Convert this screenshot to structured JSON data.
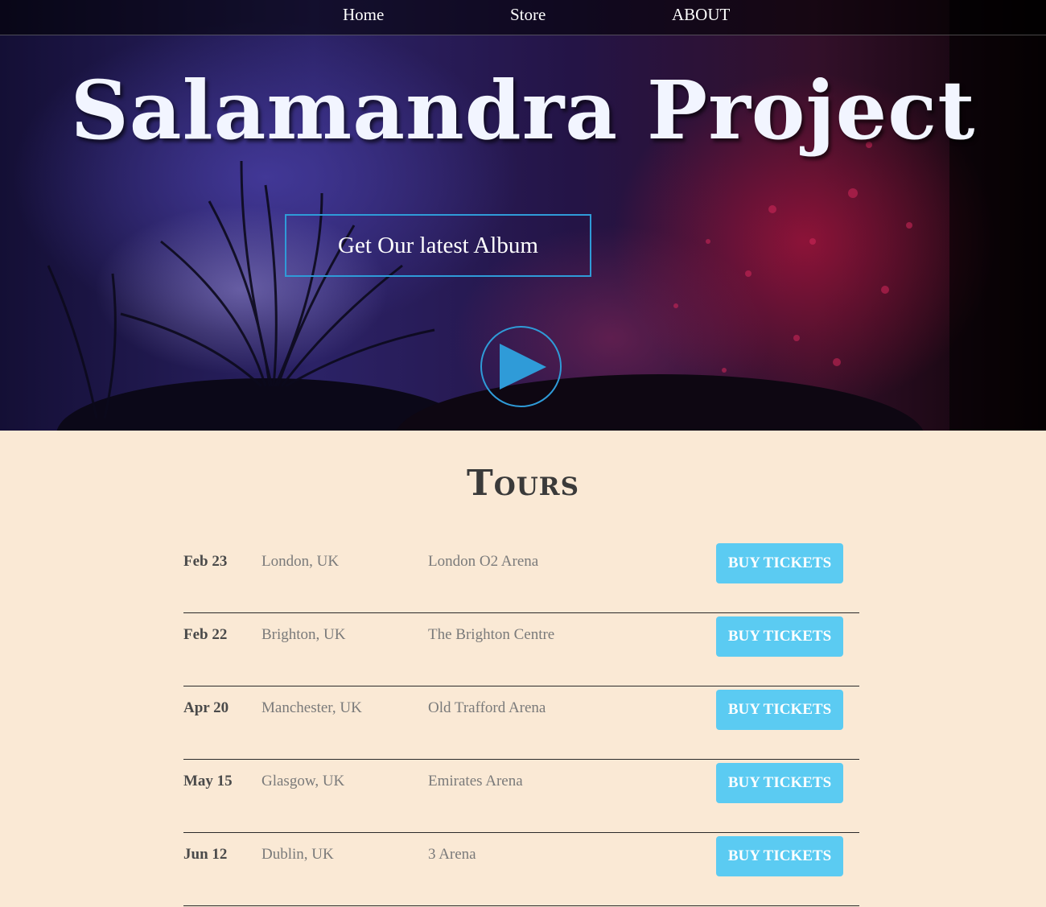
{
  "nav": {
    "home": "Home",
    "store": "Store",
    "about": "ABOUT"
  },
  "hero": {
    "title": "Salamandra Project",
    "album_button": "Get Our latest Album",
    "play_icon": "play-icon",
    "accent_color": "#2f9bd8"
  },
  "tours": {
    "title": "Tours",
    "button_color": "#5bcbf2",
    "rows": [
      {
        "date": "Feb 23",
        "city": "London, UK",
        "venue": "London O2 Arena",
        "button": "BUY TICKETS"
      },
      {
        "date": "Feb 22",
        "city": "Brighton, UK",
        "venue": "The Brighton Centre",
        "button": "BUY TICKETS"
      },
      {
        "date": "Apr 20",
        "city": "Manchester, UK",
        "venue": "Old Trafford Arena",
        "button": "BUY TICKETS"
      },
      {
        "date": "May 15",
        "city": "Glasgow, UK",
        "venue": "Emirates Arena",
        "button": "BUY TICKETS"
      },
      {
        "date": "Jun 12",
        "city": "Dublin, UK",
        "venue": "3 Arena",
        "button": "BUY TICKETS"
      }
    ]
  }
}
